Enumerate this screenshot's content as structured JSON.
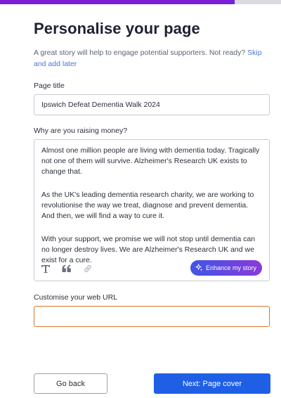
{
  "progress": {
    "fraction": 0.835,
    "fill_color": "#7a1fd6",
    "track_color": "#d9d9de"
  },
  "heading": "Personalise your page",
  "intro": {
    "text": "A great story will help to engage potential supporters. Not ready? ",
    "link": "Skip and add later"
  },
  "page_title_field": {
    "label": "Page title",
    "value": "Ipswich Defeat Dementia Walk 2024"
  },
  "story_field": {
    "label": "Why are you raising money?",
    "paragraphs": [
      "Almost one million people are living with dementia today. Tragically not one of them will survive. Alzheimer's Research UK exists to change that.",
      "As the UK's leading dementia research charity, we are working to revolutionise the way we treat, diagnose and prevent dementia. And then, we will find a way to cure it.",
      "With your support, we promise we will not stop until dementia can no longer destroy lives. We are Alzheimer's Research UK and we exist for a cure."
    ],
    "toolbar": {
      "icons": [
        "text-format-icon",
        "quote-icon",
        "link-icon"
      ]
    },
    "enhance_label": "Enhance my story"
  },
  "url_field": {
    "label": "Customise your web URL",
    "value": "",
    "border_color": "#d9772f"
  },
  "buttons": {
    "back": "Go back",
    "next": "Next: Page cover",
    "next_color": "#1e5fe6"
  }
}
